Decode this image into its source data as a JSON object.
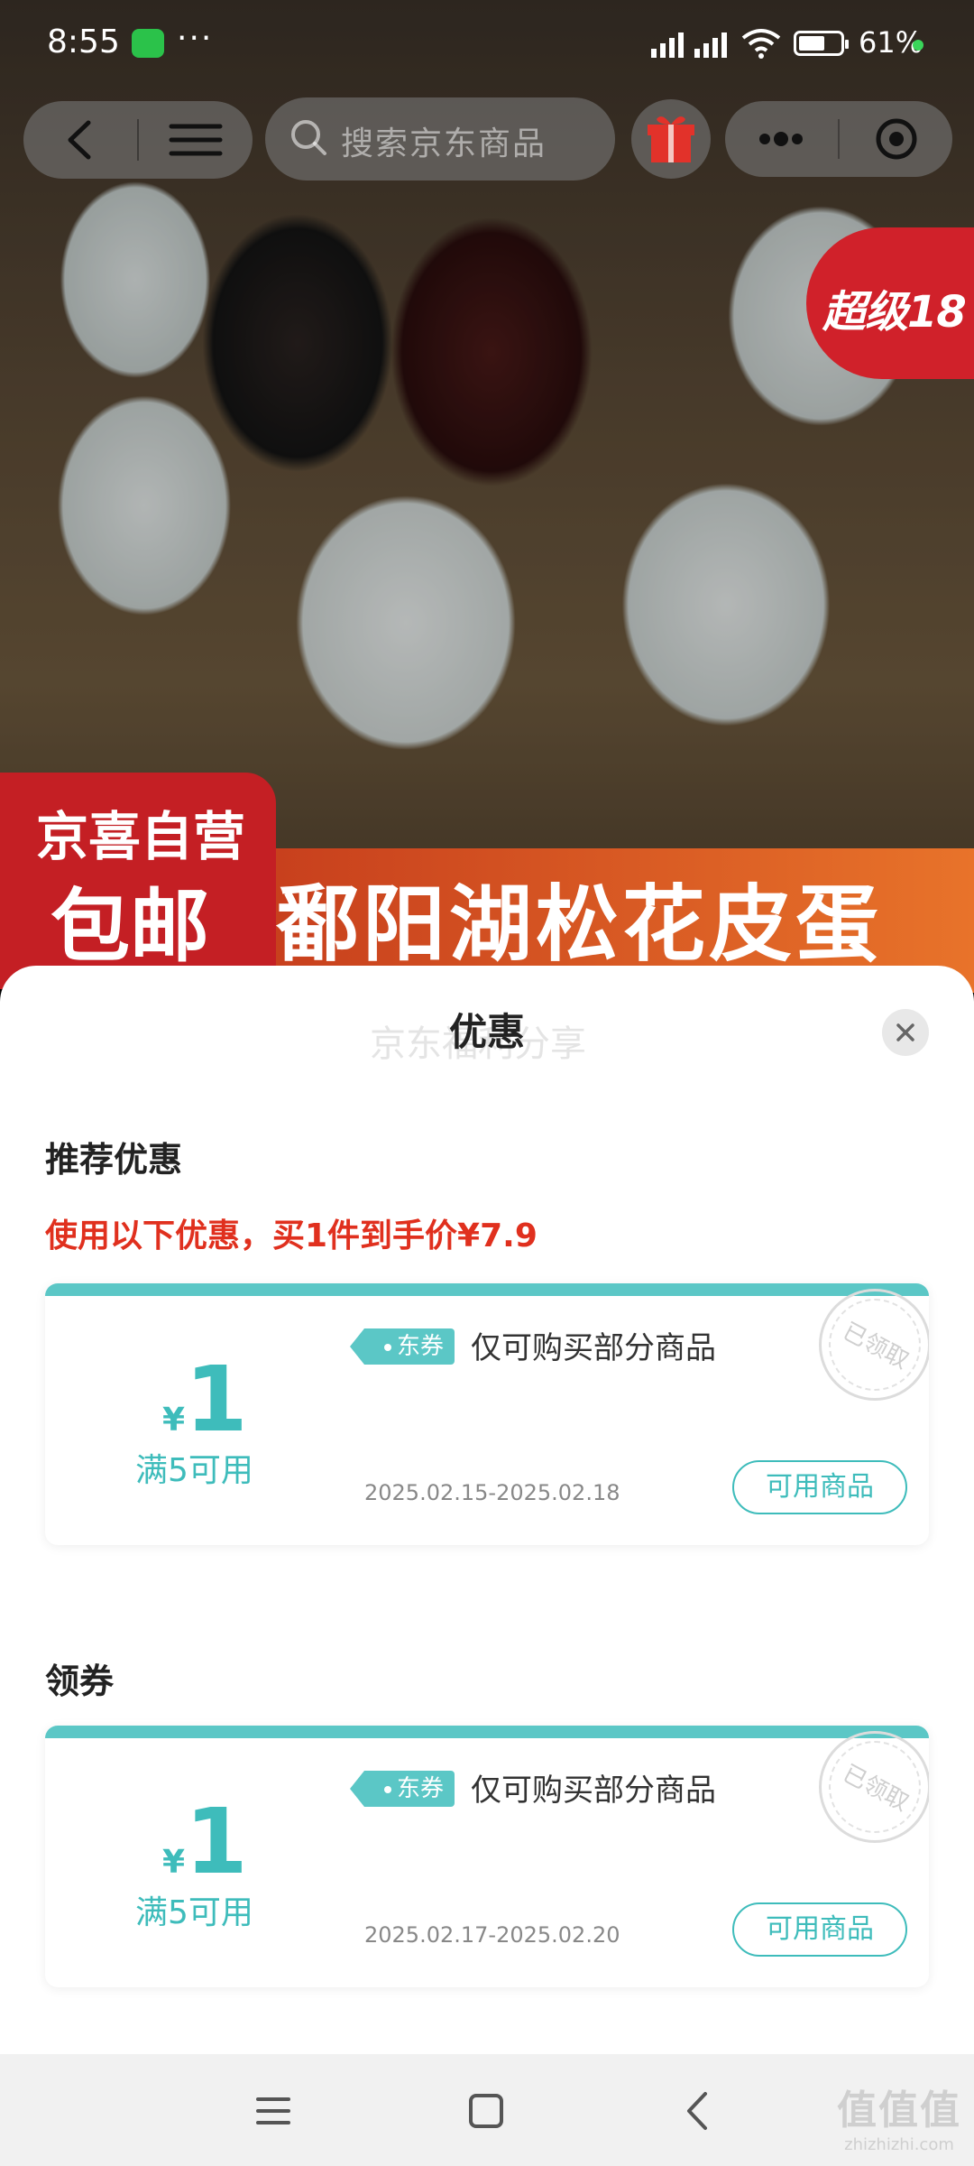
{
  "status_bar": {
    "time": "8:55",
    "more": "···",
    "battery": "61%"
  },
  "top_nav": {
    "search_placeholder": "搜索京东商品"
  },
  "product_image": {
    "super_tag": "超级18",
    "badge_top": "京喜自营",
    "badge_bottom": "包邮",
    "title": "鄱阳湖松花皮蛋"
  },
  "sheet": {
    "watermark": "京东福利分享",
    "title": "优惠",
    "recommend_title": "推荐优惠",
    "recommend_note": "使用以下优惠，买1件到手价¥7.9",
    "claim_title": "领券",
    "coupons": [
      {
        "currency": "¥",
        "value": "1",
        "condition": "满5可用",
        "tag": "东券",
        "description": "仅可购买部分商品",
        "date_range": "2025.02.15-2025.02.18",
        "button": "可用商品",
        "stamp": "已领取"
      },
      {
        "currency": "¥",
        "value": "1",
        "condition": "满5可用",
        "tag": "东券",
        "description": "仅可购买部分商品",
        "date_range": "2025.02.17-2025.02.20",
        "button": "可用商品",
        "stamp": "已领取"
      }
    ]
  },
  "watermark": {
    "main": "值值值",
    "sub": "zhizhizhi.com"
  },
  "colors": {
    "accent_teal": "#3ebcbb",
    "coupon_bar": "#5bc7c6",
    "price_red": "#e0301e",
    "badge_red": "#c41f24"
  }
}
